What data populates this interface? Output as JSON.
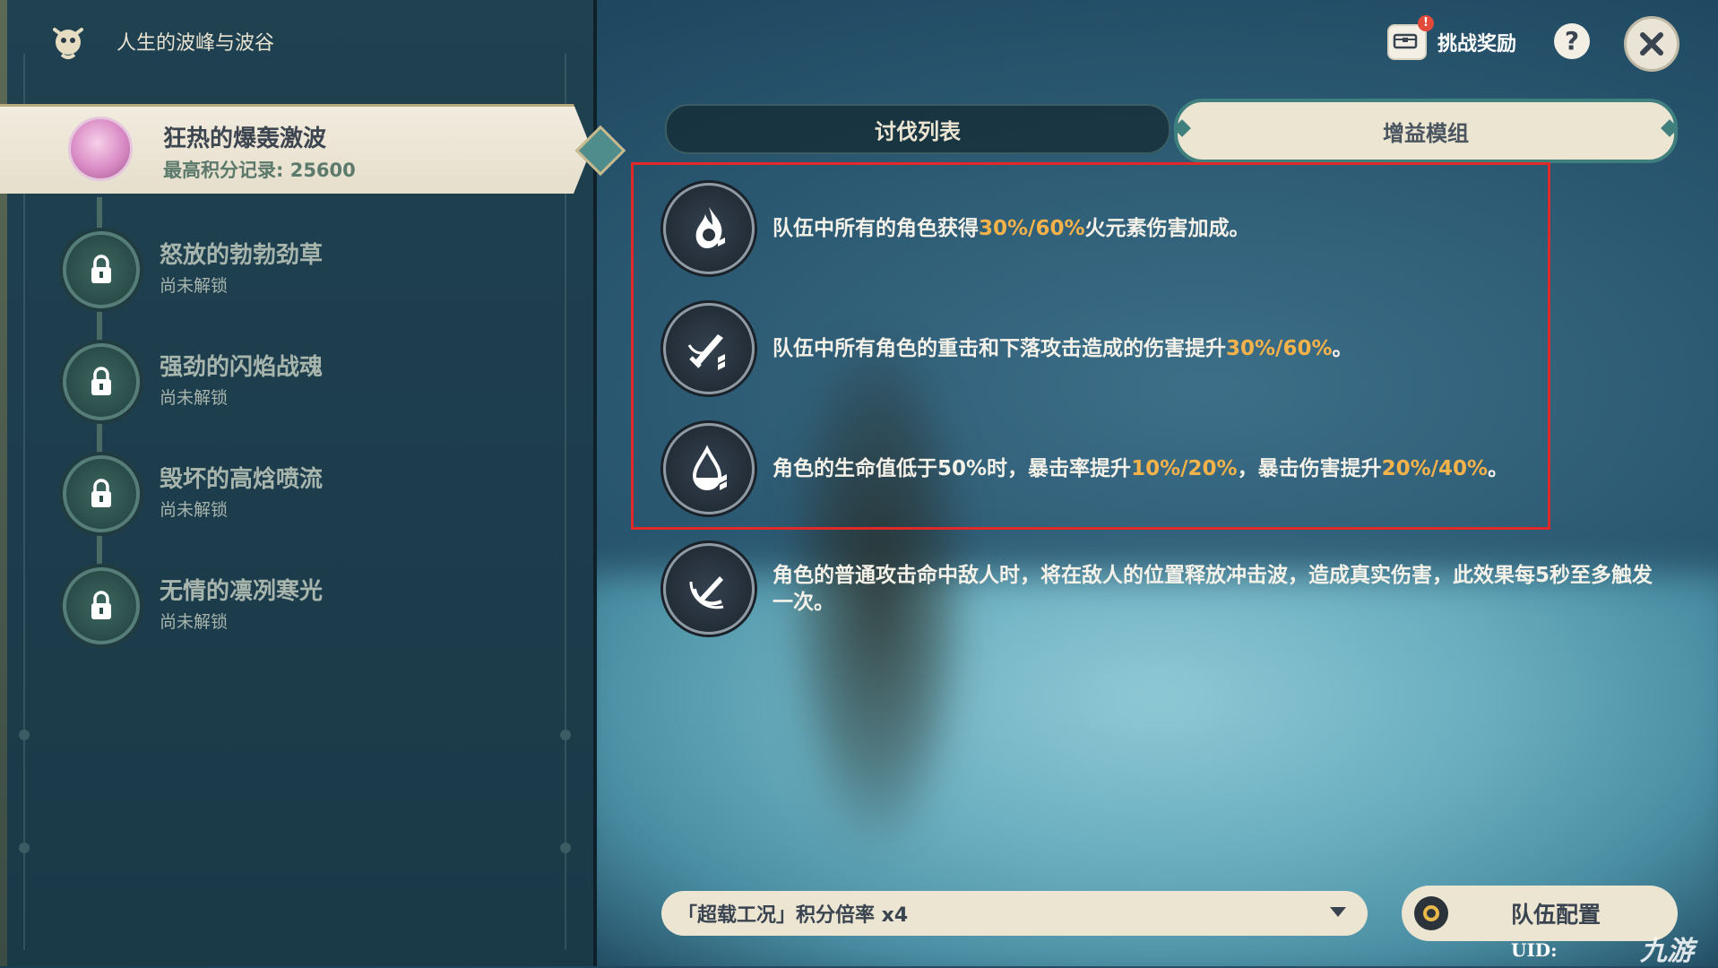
{
  "header": {
    "title": "人生的波峰与波谷",
    "reward_label": "挑战奖励",
    "reward_badge": "!",
    "help_label": "?"
  },
  "sidebar": {
    "selected": {
      "name": "狂热的爆轰激波",
      "score": "最高积分记录: 25600"
    },
    "items": [
      {
        "name": "怒放的勃勃劲草",
        "status": "尚未解锁"
      },
      {
        "name": "强劲的闪焰战魂",
        "status": "尚未解锁"
      },
      {
        "name": "毁坏的高焓喷流",
        "status": "尚未解锁"
      },
      {
        "name": "无情的凛冽寒光",
        "status": "尚未解锁"
      }
    ]
  },
  "tabs": {
    "left": "讨伐列表",
    "right": "增益模组"
  },
  "buffs": [
    {
      "icon": "pyro-buff-icon",
      "pre": "队伍中所有的角色获得",
      "hl": "30%/60%",
      "post": "火元素伤害加成。"
    },
    {
      "icon": "sword-buff-icon",
      "pre": "队伍中所有角色的重击和下落攻击造成的伤害提升",
      "hl": "30%/60%",
      "post": "。"
    },
    {
      "icon": "drop-buff-icon",
      "pre": "角色的生命值低于50%时，暴击率提升",
      "hl": "10%/20%",
      "mid": "，暴击伤害提升",
      "hl2": "20%/40%",
      "post": "。"
    },
    {
      "icon": "shockwave-buff-icon",
      "text": "角色的普通攻击命中敌人时，将在敌人的位置释放冲击波，造成真实伤害，此效果每5秒至多触发一次。"
    }
  ],
  "footer": {
    "bonus_select": "「超载工况」积分倍率 x4",
    "team_button": "队伍配置",
    "uid_label": "UID:",
    "watermark": "九游"
  },
  "colors": {
    "highlight": "#f3b24a",
    "selection_box": "#e02a2a",
    "panel": "#1e3f4e",
    "plate": "#ece5d2"
  }
}
